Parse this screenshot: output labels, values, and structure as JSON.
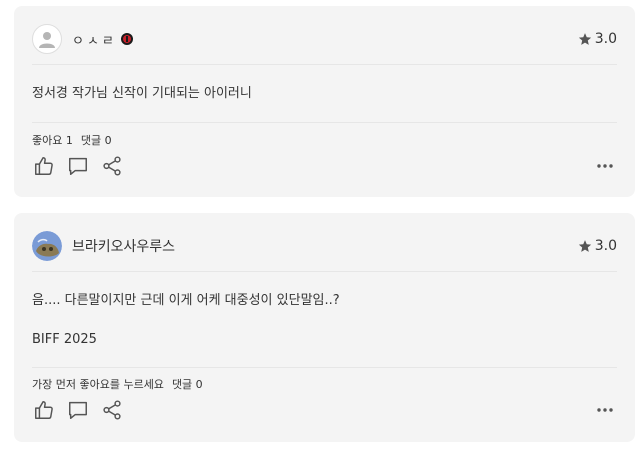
{
  "reviews": [
    {
      "username": "ㅇㅅㄹ",
      "rating": "3.0",
      "text_lines": [
        "정서경 작가님 신작이 기대되는 아이러니"
      ],
      "counts": {
        "likes": "좋아요 1",
        "comments": "댓글 0"
      },
      "icons": [
        "user-placeholder-icon",
        "red-badge-icon",
        "star-icon",
        "thumbs-up-icon",
        "comment-icon",
        "share-icon",
        "more-icon"
      ]
    },
    {
      "username": "브라키오사우루스",
      "rating": "3.0",
      "text_lines": [
        "음.... 다른말이지만 근데 이게 어케 대중성이 있단말임..?",
        "BIFF 2025"
      ],
      "counts": {
        "likes": "가장 먼저 좋아요를 누르세요",
        "comments": "댓글 0"
      },
      "icons": [
        "avatar-photo",
        "star-icon",
        "thumbs-up-icon",
        "comment-icon",
        "share-icon",
        "more-icon"
      ]
    }
  ],
  "colors": {
    "card_bg": "#f4f4f4",
    "badge_red": "#c8202a",
    "icon_gray": "#555555"
  }
}
